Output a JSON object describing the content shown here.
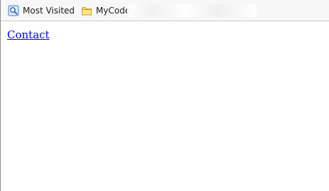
{
  "bookmarks": [
    {
      "label": "Most Visited",
      "icon": "most-visited-icon"
    },
    {
      "label": "MyCode",
      "icon": "folder-icon"
    }
  ],
  "page": {
    "link_text": "Contact"
  },
  "colors": {
    "link": "#0000ee",
    "toolbar_bg": "#f7f7f7",
    "folder_fill": "#f5d96b"
  }
}
